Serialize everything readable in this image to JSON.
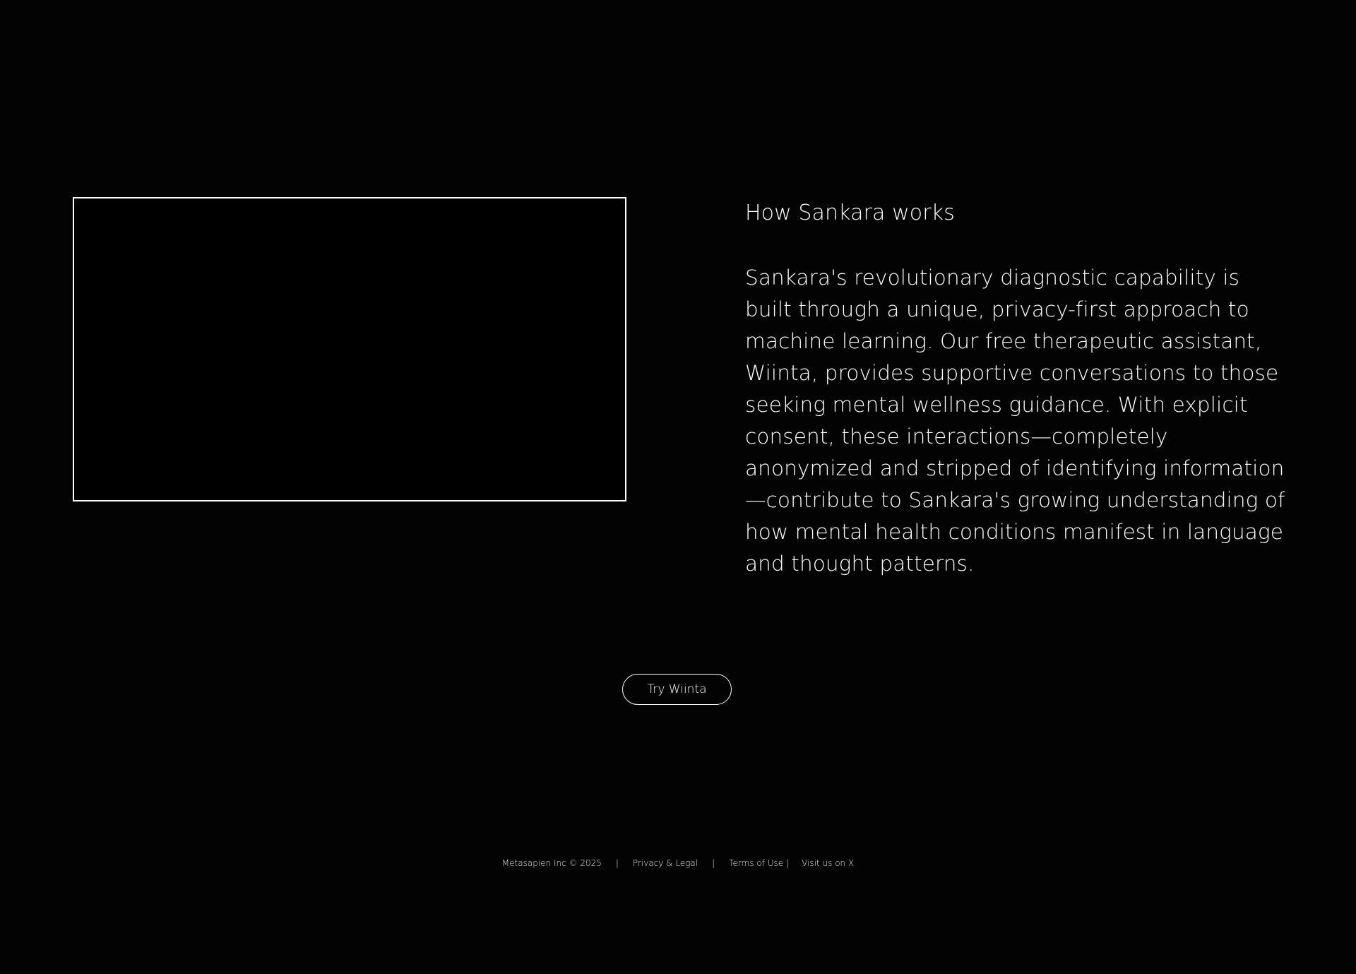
{
  "section": {
    "title": "How Sankara works",
    "body": "Sankara's revolutionary diagnostic capability is built through a unique, privacy-first approach to machine learning. Our free therapeutic assistant, Wiinta, provides supportive conversations to those seeking mental wellness guidance. With explicit consent, these interactions—completely anonymized and stripped of identifying information—contribute to Sankara's growing understanding of how mental health conditions manifest in language and thought patterns."
  },
  "cta": {
    "label": "Try Wiinta"
  },
  "footer": {
    "copyright": "Metasapien Inc © 2025",
    "separator": "|",
    "privacy_label": "Privacy & Legal",
    "terms_label": "Terms of Use",
    "social_label": "Visit us on X"
  },
  "colors": {
    "background": "#030303",
    "foreground": "#ffffff"
  }
}
